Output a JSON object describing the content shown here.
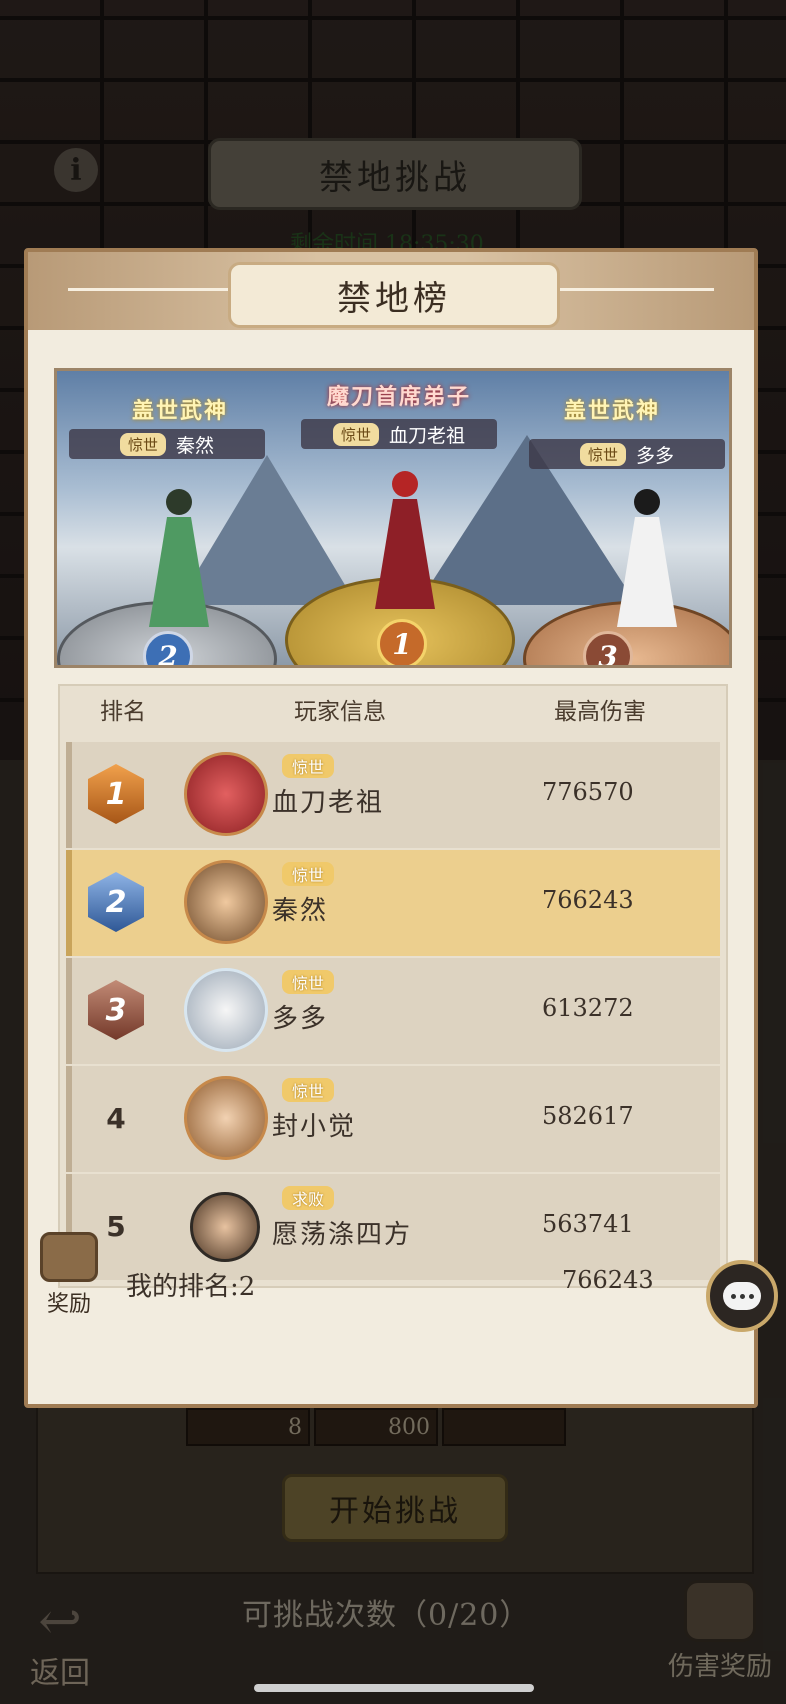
{
  "background": {
    "screen_title": "禁地挑战",
    "info_icon": "i",
    "timer_text": "剩余时间 18:35:30",
    "cells": [
      "8",
      "800",
      ""
    ],
    "start_button": "开始挑战",
    "attempts_text": "可挑战次数（0/20）",
    "back_label": "返回",
    "damage_reward_label": "伤害奖励"
  },
  "modal": {
    "title": "禁地榜",
    "podium": {
      "first": {
        "title": "魔刀首席弟子",
        "tier": "惊世",
        "name": "血刀老祖",
        "place": "1"
      },
      "second": {
        "title": "盖世武神",
        "tier": "惊世",
        "name": "秦然",
        "place": "2"
      },
      "third": {
        "title": "盖世武神",
        "tier": "惊世",
        "name": "多多",
        "place": "3"
      }
    },
    "table": {
      "headers": {
        "rank": "排名",
        "info": "玩家信息",
        "damage": "最高伤害"
      },
      "rows": [
        {
          "rank": "1",
          "tier": "惊世",
          "name": "血刀老祖",
          "damage": "776570"
        },
        {
          "rank": "2",
          "tier": "惊世",
          "name": "秦然",
          "damage": "766243"
        },
        {
          "rank": "3",
          "tier": "惊世",
          "name": "多多",
          "damage": "613272"
        },
        {
          "rank": "4",
          "tier": "惊世",
          "name": "封小觉",
          "damage": "582617"
        },
        {
          "rank": "5",
          "tier": "求败",
          "name": "愿荡涤四方",
          "damage": "563741"
        }
      ]
    },
    "my_rank_text": "我的排名:2",
    "my_damage": "766243",
    "reward_label": "奖励"
  }
}
